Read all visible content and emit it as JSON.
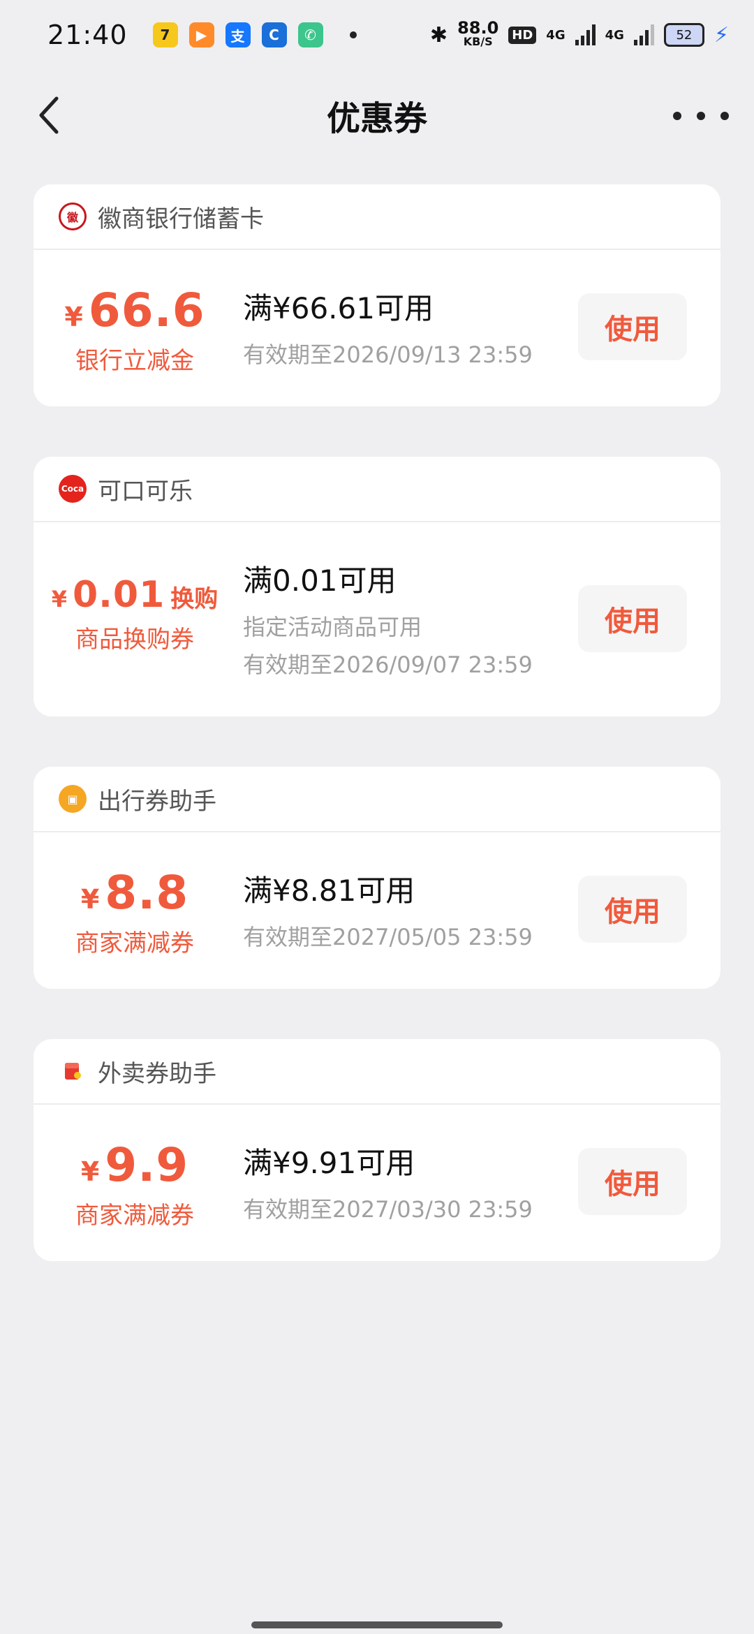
{
  "status_bar": {
    "time": "21:40",
    "net_speed": "88.0",
    "net_speed_unit": "KB/S",
    "hd": "HD",
    "signal1_label": "4G",
    "signal2_label": "4G",
    "battery": "52"
  },
  "nav": {
    "title": "优惠券"
  },
  "coupons": [
    {
      "merchant": "徽商银行储蓄卡",
      "currency": "¥",
      "amount": "66.6",
      "amount_suffix": "",
      "type": "银行立减金",
      "condition": "满¥66.61可用",
      "note": "",
      "validity": "有效期至2026/09/13 23:59",
      "button": "使用"
    },
    {
      "merchant": "可口可乐",
      "currency": "¥",
      "amount": "0.01",
      "amount_suffix": "换购",
      "type": "商品换购券",
      "condition": "满0.01可用",
      "note": "指定活动商品可用",
      "validity": "有效期至2026/09/07 23:59",
      "button": "使用"
    },
    {
      "merchant": "出行券助手",
      "currency": "¥",
      "amount": "8.8",
      "amount_suffix": "",
      "type": "商家满减券",
      "condition": "满¥8.81可用",
      "note": "",
      "validity": "有效期至2027/05/05 23:59",
      "button": "使用"
    },
    {
      "merchant": "外卖券助手",
      "currency": "¥",
      "amount": "9.9",
      "amount_suffix": "",
      "type": "商家满减券",
      "condition": "满¥9.91可用",
      "note": "",
      "validity": "有效期至2027/03/30 23:59",
      "button": "使用"
    }
  ],
  "colors": {
    "accent": "#f05a3c",
    "background": "#efeff1"
  }
}
